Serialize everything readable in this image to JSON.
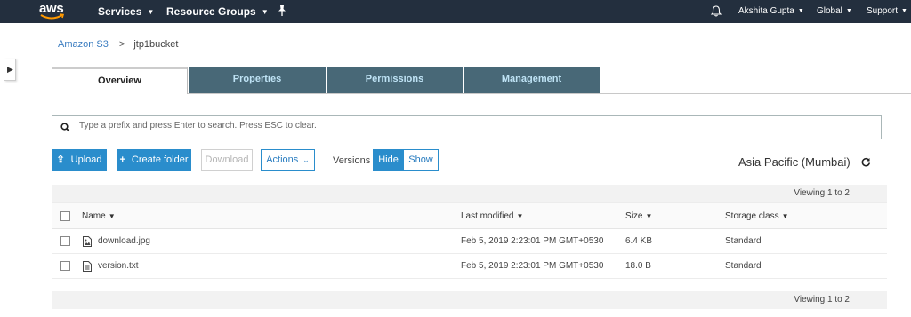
{
  "topnav": {
    "logo_text": "aws",
    "services": "Services",
    "resource_groups": "Resource Groups",
    "user": "Akshita Gupta",
    "region": "Global",
    "support": "Support",
    "background_color": "#232f3e"
  },
  "breadcrumb": {
    "root": "Amazon S3",
    "separator": ">",
    "current": "jtp1bucket"
  },
  "tabs": [
    {
      "label": "Overview",
      "active": true
    },
    {
      "label": "Properties",
      "active": false
    },
    {
      "label": "Permissions",
      "active": false
    },
    {
      "label": "Management",
      "active": false
    }
  ],
  "search": {
    "placeholder": "Type a prefix and press Enter to search. Press ESC to clear."
  },
  "toolbar": {
    "upload": "Upload",
    "create_folder": "Create folder",
    "download": "Download",
    "actions": "Actions",
    "versions_label": "Versions",
    "hide": "Hide",
    "show": "Show",
    "region": "Asia Pacific (Mumbai)"
  },
  "table": {
    "viewing_text": "Viewing 1 to 2",
    "columns": {
      "name": "Name",
      "last_modified": "Last modified",
      "size": "Size",
      "storage_class": "Storage class"
    },
    "rows": [
      {
        "icon": "image-file-icon",
        "name": "download.jpg",
        "last_modified": "Feb 5, 2019 2:23:01 PM GMT+0530",
        "size": "6.4 KB",
        "storage_class": "Standard"
      },
      {
        "icon": "text-file-icon",
        "name": "version.txt",
        "last_modified": "Feb 5, 2019 2:23:01 PM GMT+0530",
        "size": "18.0 B",
        "storage_class": "Standard"
      }
    ],
    "footer_text": "Viewing 1 to 2"
  },
  "colors": {
    "accent": "#2a8dcc",
    "tab_inactive": "#486877",
    "link": "#3a7cc0"
  }
}
